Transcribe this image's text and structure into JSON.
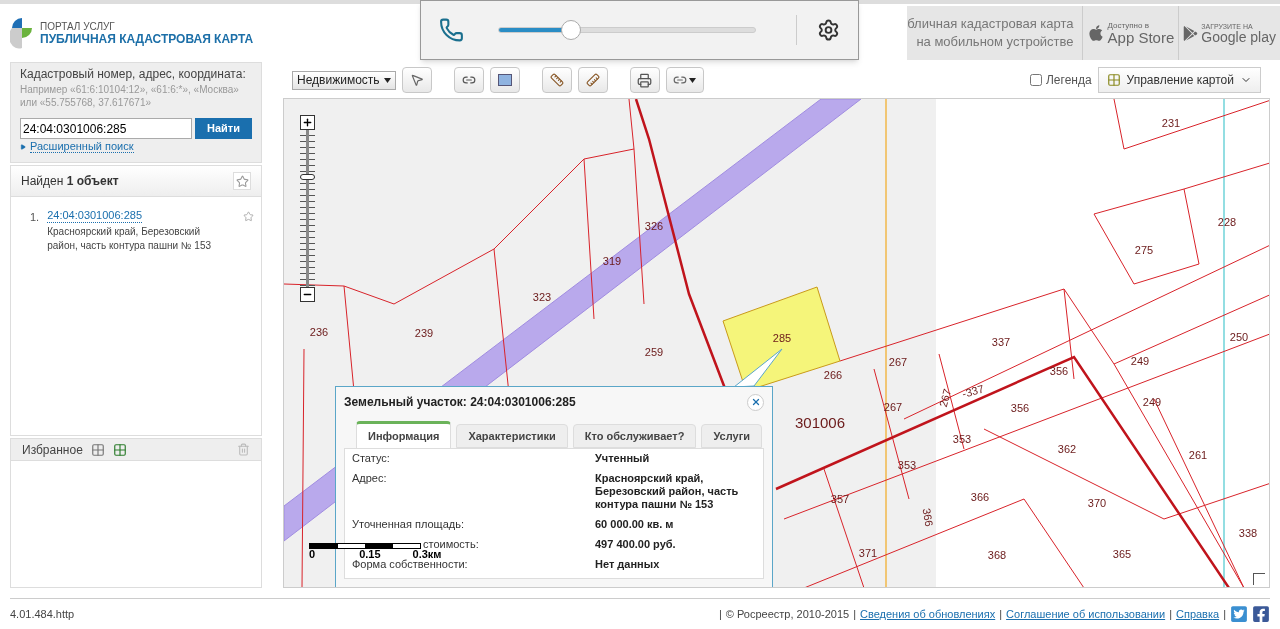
{
  "header": {
    "portal": "ПОРТАЛ УСЛУГ",
    "title": "ПУБЛИЧНАЯ КАДАСТРОВАЯ КАРТА",
    "mobile_line_1": "бличная кадастровая карта",
    "mobile_line_2": "на мобильном устройстве",
    "app_store": {
      "small": "Доступно в",
      "big": "App Store"
    },
    "google_play": {
      "small": "ЗАГРУЗИТЕ НА",
      "big": "Google play"
    }
  },
  "media_overlay": {
    "volume": {
      "level": 0.28
    }
  },
  "search": {
    "label": "Кадастровый номер, адрес, координата:",
    "hint": "Например «61:6:10104:12», «61:6:*», «Москва» или «55.755768, 37.617671»",
    "value": "24:04:0301006:285",
    "button": "Найти",
    "advanced": "Расширенный поиск"
  },
  "results": {
    "prefix": "Найден",
    "count": "1 объект",
    "items": [
      {
        "number": "1.",
        "link": "24:04:0301006:285",
        "address": "Красноярский край, Березовский район, часть контура пашни № 153"
      }
    ]
  },
  "favorites": {
    "title": "Избранное"
  },
  "toolbar": {
    "layer": "Недвижимость",
    "legend": {
      "label": "Легенда",
      "checked": false
    },
    "map_control": "Управление картой"
  },
  "map": {
    "zoom": {
      "level": 0.71
    },
    "parcel_labels": [
      "231",
      "228",
      "275",
      "326",
      "319",
      "323",
      "236",
      "239",
      "259",
      "285",
      "337",
      "250",
      "249",
      "267",
      "266",
      "267",
      "356",
      "356",
      "249",
      "353",
      "362",
      "261",
      "353",
      "357",
      "366",
      "370",
      "366",
      "338",
      "371",
      "368",
      "365",
      "267",
      "-337"
    ],
    "block_label": "301006",
    "scale": {
      "labels": [
        "0",
        "0.15",
        "0.3км"
      ]
    }
  },
  "popup": {
    "title": "Земельный участок: 24:04:0301006:285",
    "tabs": [
      {
        "label": "Информация",
        "selected": true
      },
      {
        "label": "Характеристики",
        "selected": false
      },
      {
        "label": "Кто обслуживает?",
        "selected": false
      },
      {
        "label": "Услуги",
        "selected": false
      }
    ],
    "rows": [
      {
        "label": "Статус:",
        "value": "Учтенный"
      },
      {
        "label": "Адрес:",
        "value": "Красноярский край, Березовский район, часть контура пашни № 153"
      },
      {
        "label": "Уточненная площадь:",
        "value": "60 000.00 кв. м"
      },
      {
        "label": "стоимость:",
        "value": "497 400.00 руб."
      },
      {
        "label": "Форма собственности:",
        "value": "Нет данных"
      }
    ]
  },
  "footer": {
    "version": "4.01.484.http",
    "items": [
      {
        "kind": "sep",
        "text": "|"
      },
      {
        "kind": "text",
        "text": "© Росреестр, 2010-2015"
      },
      {
        "kind": "sep",
        "text": "|"
      },
      {
        "kind": "link",
        "text": "Сведения об обновлениях"
      },
      {
        "kind": "sep",
        "text": "|"
      },
      {
        "kind": "link",
        "text": "Соглашение об использовании"
      },
      {
        "kind": "sep",
        "text": "|"
      },
      {
        "kind": "link",
        "text": "Справка"
      },
      {
        "kind": "sep",
        "text": "|"
      }
    ]
  }
}
